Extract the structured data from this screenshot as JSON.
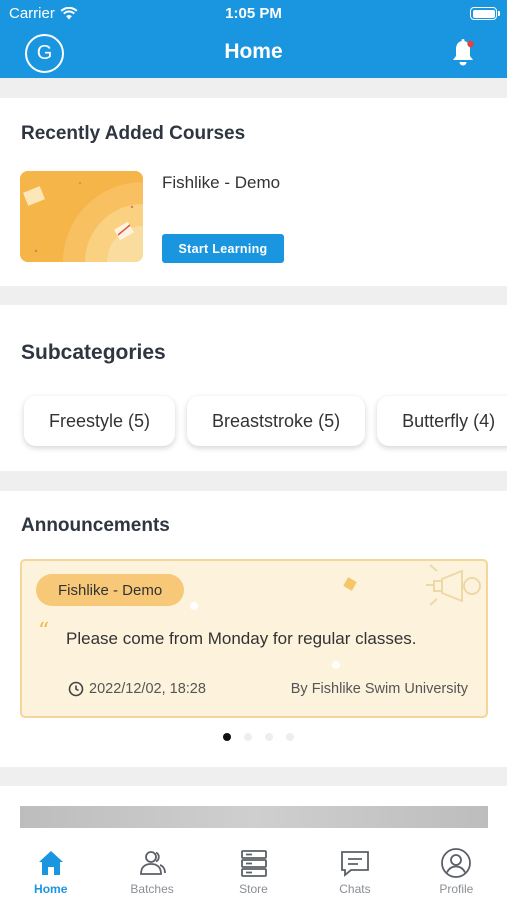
{
  "status_bar": {
    "carrier": "Carrier",
    "time": "1:05 PM"
  },
  "nav": {
    "avatar_letter": "G",
    "title": "Home"
  },
  "courses": {
    "title": "Recently Added Courses",
    "items": [
      {
        "name": "Fishlike - Demo",
        "button": "Start Learning"
      }
    ]
  },
  "subcategories": {
    "title": "Subcategories",
    "chips": [
      "Freestyle (5)",
      "Breaststroke (5)",
      "Butterfly (4)"
    ]
  },
  "announcements": {
    "title": "Announcements",
    "card": {
      "tag": "Fishlike - Demo",
      "text": "Please come from Monday for regular classes.",
      "date": "2022/12/02, 18:28",
      "by": "By Fishlike Swim University"
    },
    "page_count": 4,
    "active_page": 1
  },
  "tabs": [
    {
      "label": "Home",
      "icon": "home-icon",
      "active": true
    },
    {
      "label": "Batches",
      "icon": "batches-icon",
      "active": false
    },
    {
      "label": "Store",
      "icon": "store-icon",
      "active": false
    },
    {
      "label": "Chats",
      "icon": "chats-icon",
      "active": false
    },
    {
      "label": "Profile",
      "icon": "profile-icon",
      "active": false
    }
  ],
  "colors": {
    "primary": "#1a96e0",
    "tag": "#f6c878",
    "card_bg": "#fdf3dc"
  }
}
